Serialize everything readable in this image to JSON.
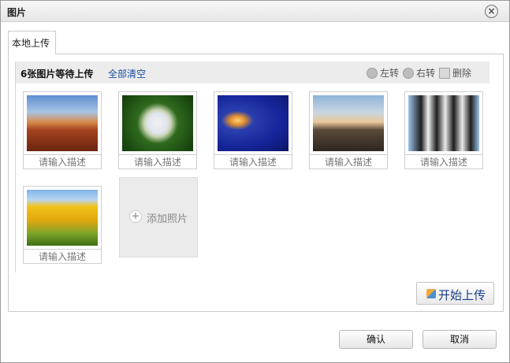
{
  "dialog": {
    "title": "图片"
  },
  "tabs": [
    {
      "label": "本地上传"
    }
  ],
  "toolbar": {
    "upload_count": "6张图片等待上传",
    "clear_all": "全部清空",
    "rotate_left": "左转",
    "rotate_right": "右转",
    "delete": "删除"
  },
  "photos": [
    {
      "icon": "desert-photo",
      "placeholder": "请输入描述"
    },
    {
      "icon": "hydrangea-photo",
      "placeholder": "请输入描述"
    },
    {
      "icon": "jellyfish-photo",
      "placeholder": "请输入描述"
    },
    {
      "icon": "lighthouse-photo",
      "placeholder": "请输入描述"
    },
    {
      "icon": "penguins-photo",
      "placeholder": "请输入描述"
    },
    {
      "icon": "tulips-photo",
      "placeholder": "请输入描述"
    }
  ],
  "add_photo": {
    "label": "添加照片"
  },
  "start_upload": {
    "label": "开始上传"
  },
  "footer": {
    "confirm": "确认",
    "cancel": "取消"
  }
}
